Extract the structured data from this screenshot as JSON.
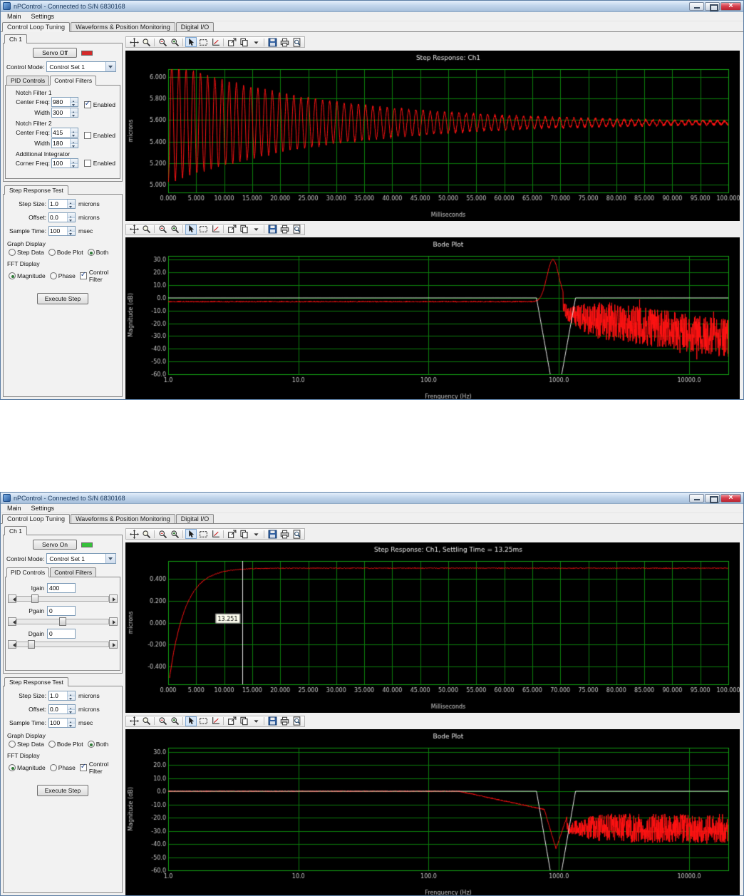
{
  "shared": {
    "window_title": "nPControl - Connected to S/N 6830168",
    "menu": [
      "Main",
      "Settings"
    ],
    "main_tabs": [
      "Control Loop Tuning",
      "Waveforms & Position Monitoring",
      "Digital I/O"
    ],
    "channel_tab": "Ch 1",
    "control_mode_label": "Control Mode:",
    "control_mode_value": "Control Set 1",
    "pid_tab": "PID Controls",
    "filters_tab": "Control Filters",
    "step_test": {
      "tab_label": "Step Response Test",
      "rows": [
        {
          "label": "Step Size:",
          "value": "1.0",
          "unit": "microns"
        },
        {
          "label": "Offset:",
          "value": "0.0",
          "unit": "microns"
        },
        {
          "label": "Sample Time:",
          "value": "100",
          "unit": "msec"
        }
      ],
      "graph_display_label": "Graph Display",
      "graph_options": [
        {
          "label": "Step Data",
          "selected": false
        },
        {
          "label": "Bode Plot",
          "selected": false
        },
        {
          "label": "Both",
          "selected": true
        }
      ],
      "fft_display_label": "FFT Display",
      "fft_options": [
        {
          "label": "Magnitude",
          "selected": true
        },
        {
          "label": "Phase",
          "selected": false
        }
      ],
      "control_filter": {
        "label": "Control Filter",
        "checked": true
      },
      "execute_label": "Execute Step"
    },
    "toolbar_icons": [
      "pan-tool",
      "zoom-window",
      "|",
      "zoom-out",
      "zoom-in",
      "|",
      "select-cursor",
      "zoom-box",
      "fit-view",
      "|",
      "export-graph",
      "copy-graph",
      "copy-caret",
      "|",
      "save-graph",
      "print-graph",
      "print-preview"
    ],
    "toolbar_active": "select-cursor"
  },
  "window_top": {
    "servo_label": "Servo Off",
    "led_color": "#d42a2a",
    "filters": {
      "groups": [
        {
          "title": "Notch Filter 1",
          "rows": [
            {
              "label": "Center Freq:",
              "value": "980"
            },
            {
              "label": "Width",
              "value": "300"
            }
          ],
          "enabled_label": "Enabled",
          "enabled": true
        },
        {
          "title": "Notch Filter 2",
          "rows": [
            {
              "label": "Center Freq:",
              "value": "415"
            },
            {
              "label": "Width",
              "value": "180"
            }
          ],
          "enabled_label": "Enabled",
          "enabled": false
        },
        {
          "title": "Additional Integrator",
          "rows": [
            {
              "label": "Corner Freq:",
              "value": "100"
            }
          ],
          "enabled_label": "Enabled",
          "enabled": false
        }
      ]
    }
  },
  "window_bottom": {
    "servo_label": "Servo On",
    "led_color": "#35c13a",
    "pid": {
      "rows": [
        {
          "label": "Igain",
          "value": "400",
          "slider_pos": 16
        },
        {
          "label": "Pgain",
          "value": "0",
          "slider_pos": 46
        },
        {
          "label": "Dgain",
          "value": "0",
          "slider_pos": 12
        }
      ]
    }
  },
  "chart_style": {
    "bg": "#000000",
    "grid": "#0b7a0b",
    "frame": "#12a012",
    "tick_color": "#c8c8c8",
    "title_color": "#e8e8e8",
    "label_color": "#c8c8c8"
  },
  "chart_data": [
    {
      "id": "step_response_open",
      "type": "line",
      "title": "Step Response: Ch1",
      "xlabel": "Milliseconds",
      "ylabel": "microns",
      "xscale": "linear",
      "xlim": [
        0,
        100
      ],
      "ylim": [
        4.93,
        6.07
      ],
      "xtick_vals": [
        0,
        5,
        10,
        15,
        20,
        25,
        30,
        35,
        40,
        45,
        50,
        55,
        60,
        65,
        70,
        75,
        80,
        85,
        90,
        95,
        100
      ],
      "xtick_labels": [
        "0.000",
        "5.000",
        "10.000",
        "15.000",
        "20.000",
        "25.000",
        "30.000",
        "35.000",
        "40.000",
        "45.000",
        "50.000",
        "55.000",
        "60.000",
        "65.000",
        "70.000",
        "75.000",
        "80.000",
        "85.000",
        "90.000",
        "95.000",
        "100.000"
      ],
      "ytick_vals": [
        5.0,
        5.2,
        5.4,
        5.6,
        5.8,
        6.0
      ],
      "ytick_labels": [
        "5.000",
        "5.200",
        "5.400",
        "5.600",
        "5.800",
        "6.000"
      ],
      "series": [
        {
          "name": "step-response",
          "color": "#ff1212",
          "kind": "damped_osc",
          "baseline": 5.575,
          "amplitude": 0.56,
          "decay_ms": 28,
          "freq_hz": 780,
          "noise": 0.012,
          "x_start": 0.05,
          "seed": 3
        }
      ]
    },
    {
      "id": "bode_open",
      "type": "line",
      "title": "Bode Plot",
      "xlabel": "Frenquency (Hz)",
      "ylabel": "Magnitude (dB)",
      "xscale": "log",
      "xlim": [
        1,
        20000
      ],
      "ylim": [
        -60,
        33
      ],
      "xtick_vals": [
        1,
        10,
        100,
        1000,
        10000
      ],
      "xtick_labels": [
        "1.0",
        "10.0",
        "100.0",
        "1000.0",
        "10000.0"
      ],
      "ytick_vals": [
        -60,
        -50,
        -40,
        -30,
        -20,
        -10,
        0,
        10,
        20,
        30
      ],
      "ytick_labels": [
        "-60.0",
        "-50.0",
        "-40.0",
        "-30.0",
        "-20.0",
        "-10.0",
        "0.0",
        "10.0",
        "20.0",
        "30.0"
      ],
      "series": [
        {
          "name": "fft-magnitude",
          "color": "#ff1212",
          "kind": "bode_open",
          "f_start": 4.5,
          "flat_db": -3,
          "peak_f": 900,
          "peak_gain": 33,
          "peak_sigma": 0.065,
          "noise_f": 1080,
          "noise_mean_start": -13,
          "noise_mean_end": -32,
          "noise_amp": 15,
          "seed": 7
        },
        {
          "name": "control-filter",
          "color": "#f5f5f5",
          "kind": "notch",
          "f_start": 130,
          "flat_db": 0,
          "notch_f": 950,
          "depth_db": 85,
          "half_width": 0.15
        }
      ]
    },
    {
      "id": "step_response_closed",
      "type": "line",
      "title": "Step Response: Ch1, Settling Time = 13.25ms",
      "xlabel": "Milliseconds",
      "ylabel": "microns",
      "xscale": "linear",
      "xlim": [
        0,
        100
      ],
      "ylim": [
        -0.56,
        0.56
      ],
      "xtick_vals": [
        0,
        5,
        10,
        15,
        20,
        25,
        30,
        35,
        40,
        45,
        50,
        55,
        60,
        65,
        70,
        75,
        80,
        85,
        90,
        95,
        100
      ],
      "xtick_labels": [
        "0.000",
        "5.000",
        "10.000",
        "15.000",
        "20.000",
        "25.000",
        "30.000",
        "35.000",
        "40.000",
        "45.000",
        "50.000",
        "55.000",
        "60.000",
        "65.000",
        "70.000",
        "75.000",
        "80.000",
        "85.000",
        "90.000",
        "95.000",
        "100.000"
      ],
      "ytick_vals": [
        -0.4,
        -0.2,
        0,
        0.2,
        0.4
      ],
      "ytick_labels": [
        "-0.400",
        "-0.200",
        "0.000",
        "0.200",
        "0.400"
      ],
      "series": [
        {
          "name": "step-response",
          "color": "#ff1212",
          "kind": "step_rise",
          "y0": -0.5,
          "y1": 0.495,
          "tau_ms": 2.8,
          "x_start": 0.25,
          "noise": 0.004,
          "seed": 5
        }
      ],
      "cursor": {
        "x": 13.25,
        "label": "13.251",
        "label_y": 0.03
      }
    },
    {
      "id": "bode_closed",
      "type": "line",
      "title": "Bode Plot",
      "xlabel": "Frenquency (Hz)",
      "ylabel": "Magnitude (dB)",
      "xscale": "log",
      "xlim": [
        1,
        20000
      ],
      "ylim": [
        -60,
        33
      ],
      "xtick_vals": [
        1,
        10,
        100,
        1000,
        10000
      ],
      "xtick_labels": [
        "1.0",
        "10.0",
        "100.0",
        "1000.0",
        "10000.0"
      ],
      "ytick_vals": [
        -60,
        -50,
        -40,
        -30,
        -20,
        -10,
        0,
        10,
        20,
        30
      ],
      "ytick_labels": [
        "-60.0",
        "-50.0",
        "-40.0",
        "-30.0",
        "-20.0",
        "-10.0",
        "0.0",
        "10.0",
        "20.0",
        "30.0"
      ],
      "series": [
        {
          "name": "fft-magnitude",
          "color": "#ff1212",
          "kind": "bode_closed",
          "f_start": 9,
          "corner_f": 170,
          "slope_db": 21,
          "notch_f": 950,
          "notch_extra": 28,
          "notch_half_width": 0.09,
          "noise_f": 1150,
          "noise_mean": -28,
          "noise_amp": 11,
          "seed": 13
        },
        {
          "name": "control-filter",
          "color": "#f5f5f5",
          "kind": "notch",
          "f_start": 130,
          "flat_db": 0,
          "notch_f": 950,
          "depth_db": 85,
          "half_width": 0.15
        }
      ]
    }
  ]
}
